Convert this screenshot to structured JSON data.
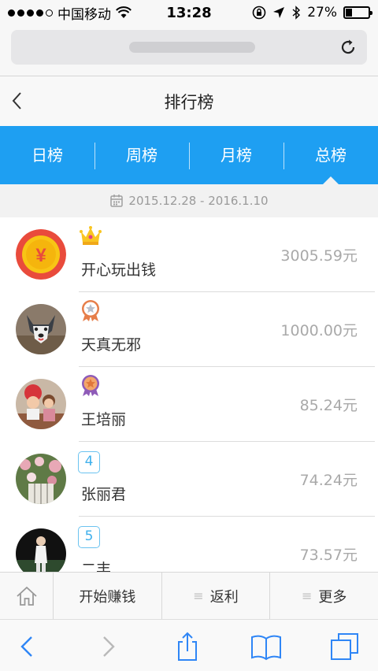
{
  "status_bar": {
    "carrier": "中国移动",
    "time": "13:28",
    "battery": "27%",
    "battery_level": 0.27
  },
  "browser": {
    "icons": {
      "reload": "reload-icon"
    }
  },
  "header": {
    "title": "排行榜"
  },
  "tabs": [
    {
      "label": "日榜"
    },
    {
      "label": "周榜"
    },
    {
      "label": "月榜"
    },
    {
      "label": "总榜"
    }
  ],
  "active_tab": "总榜",
  "date_range": "2015.12.28 - 2016.1.10",
  "leaderboard": [
    {
      "rank": "1",
      "name": "开心玩出钱",
      "amount": "3005.59元",
      "badge": "crown-icon",
      "avatar": "coin-avatar"
    },
    {
      "rank": "2",
      "name": "天真无邪",
      "amount": "1000.00元",
      "badge": "silver-medal-icon",
      "avatar": "husky-avatar"
    },
    {
      "rank": "3",
      "name": "王培丽",
      "amount": "85.24元",
      "badge": "bronze-medal-icon",
      "avatar": "kids-avatar"
    },
    {
      "rank": "4",
      "name": "张丽君",
      "amount": "74.24元",
      "badge": "",
      "avatar": "flowers-avatar"
    },
    {
      "rank": "5",
      "name": "二丰",
      "amount": "73.57元",
      "badge": "",
      "avatar": "person-avatar"
    }
  ],
  "bottom_menu": {
    "earn": "开始赚钱",
    "rebate": "返利",
    "more": "更多"
  },
  "colors": {
    "accent": "#1e9ff2",
    "amount_text": "#a9a9a9",
    "rank_box": "#6bc3f0",
    "ios_blue": "#2f86f6"
  }
}
